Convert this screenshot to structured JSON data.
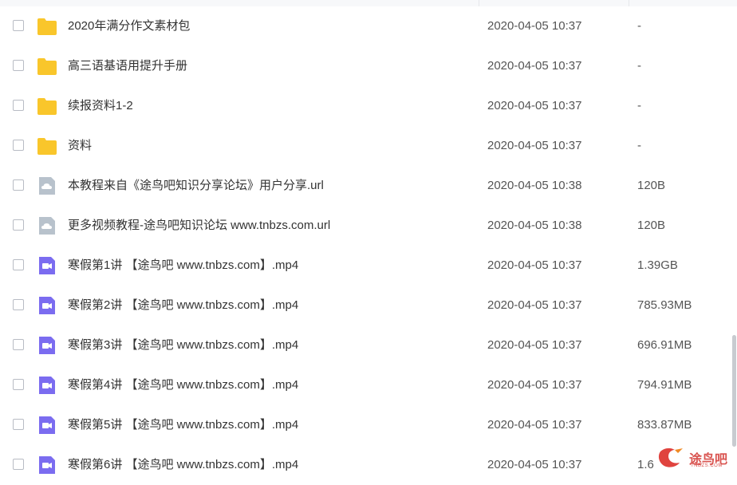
{
  "files": [
    {
      "name": "2020年满分作文素材包",
      "date": "2020-04-05 10:37",
      "size": "-",
      "icon": "folder-icon"
    },
    {
      "name": "高三语基语用提升手册",
      "date": "2020-04-05 10:37",
      "size": "-",
      "icon": "folder-icon"
    },
    {
      "name": "续报资料1-2",
      "date": "2020-04-05 10:37",
      "size": "-",
      "icon": "folder-icon"
    },
    {
      "name": "资料",
      "date": "2020-04-05 10:37",
      "size": "-",
      "icon": "folder-icon"
    },
    {
      "name": "本教程来自《途鸟吧知识分享论坛》用户分享.url",
      "date": "2020-04-05 10:38",
      "size": "120B",
      "icon": "url-file-icon"
    },
    {
      "name": "更多视频教程-途鸟吧知识论坛 www.tnbzs.com.url",
      "date": "2020-04-05 10:38",
      "size": "120B",
      "icon": "url-file-icon"
    },
    {
      "name": "寒假第1讲 【途鸟吧 www.tnbzs.com】.mp4",
      "date": "2020-04-05 10:37",
      "size": "1.39GB",
      "icon": "video-file-icon"
    },
    {
      "name": "寒假第2讲 【途鸟吧 www.tnbzs.com】.mp4",
      "date": "2020-04-05 10:37",
      "size": "785.93MB",
      "icon": "video-file-icon"
    },
    {
      "name": "寒假第3讲 【途鸟吧 www.tnbzs.com】.mp4",
      "date": "2020-04-05 10:37",
      "size": "696.91MB",
      "icon": "video-file-icon"
    },
    {
      "name": "寒假第4讲 【途鸟吧 www.tnbzs.com】.mp4",
      "date": "2020-04-05 10:37",
      "size": "794.91MB",
      "icon": "video-file-icon"
    },
    {
      "name": "寒假第5讲 【途鸟吧 www.tnbzs.com】.mp4",
      "date": "2020-04-05 10:37",
      "size": "833.87MB",
      "icon": "video-file-icon"
    },
    {
      "name": "寒假第6讲 【途鸟吧 www.tnbzs.com】.mp4",
      "date": "2020-04-05 10:37",
      "size": "1.6",
      "icon": "video-file-icon"
    }
  ],
  "watermark": {
    "text": "途鸟吧",
    "subtext": "TNBZS.COM"
  },
  "colors": {
    "folder": "#f9c62b",
    "url_file": "#b8c2cc",
    "video_file": "#7b6cf0"
  }
}
